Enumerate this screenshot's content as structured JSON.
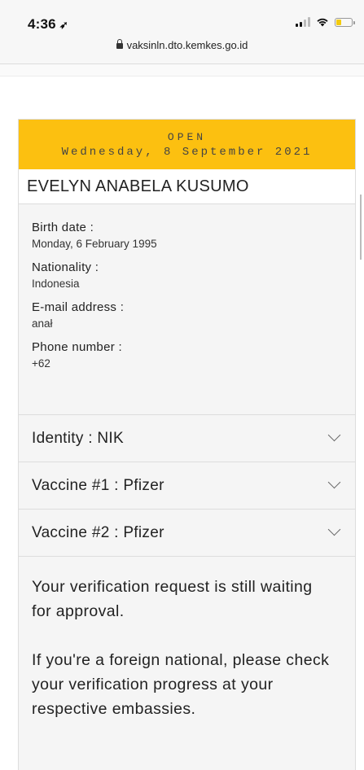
{
  "status_bar": {
    "time": "4:36",
    "location_icon": "location-arrow-icon",
    "signal_icon": "cellular-signal-icon",
    "wifi_icon": "wifi-icon",
    "battery_icon": "battery-icon",
    "battery_level": 0.35,
    "battery_color": "#f3cb0e"
  },
  "browser": {
    "lock_icon": "lock-icon",
    "url": "vaksinln.dto.kemkes.go.id"
  },
  "card": {
    "header_color": "#fcc010",
    "status": "OPEN",
    "date": "Wednesday, 8 September 2021",
    "name": "EVELYN ANABELA KUSUMO",
    "fields": [
      {
        "label": "Birth date :",
        "value": "Monday, 6 February 1995"
      },
      {
        "label": "Nationality :",
        "value": "Indonesia"
      },
      {
        "label": "E-mail address :",
        "value": "anał"
      },
      {
        "label": "Phone number :",
        "value": "+62"
      }
    ],
    "accordions": [
      {
        "label": "Identity : NIK",
        "icon": "chevron-down-icon"
      },
      {
        "label": "Vaccine #1 : Pfizer",
        "icon": "chevron-down-icon"
      },
      {
        "label": "Vaccine #2 : Pfizer",
        "icon": "chevron-down-icon"
      }
    ],
    "notice": [
      "Your verification request is still waiting for approval.",
      "If you're a foreign national, please check your verification progress at your respective embassies."
    ]
  }
}
